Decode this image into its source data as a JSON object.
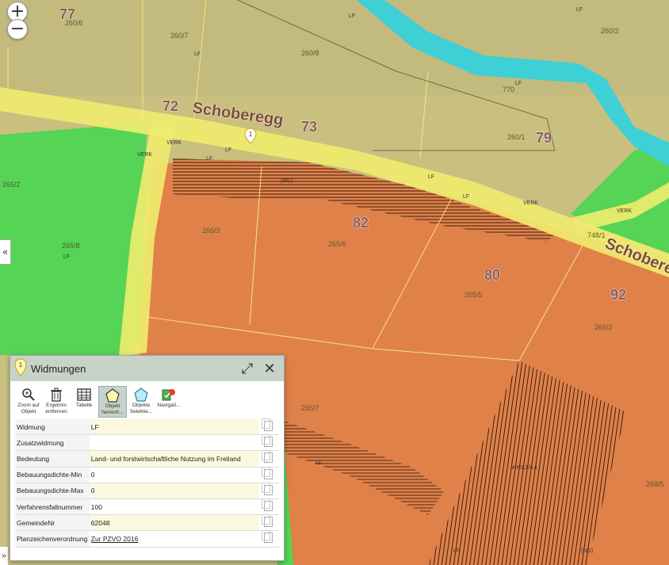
{
  "map": {
    "street_labels": [
      "Schoberegg",
      "Schobere"
    ],
    "house_numbers": [
      "77",
      "72",
      "73",
      "79",
      "82",
      "80",
      "92"
    ],
    "parcel_labels": [
      "260/6",
      "260/7",
      "260/8",
      "260/2",
      "770",
      "260/1",
      "265/2",
      "265/8",
      "265/3",
      "265/6",
      "265/5",
      "266/2",
      "748/1",
      "265/7",
      "268/5"
    ],
    "zone_labels": [
      "LF",
      "VERK",
      "(NG)",
      "WK0,2/0,4"
    ],
    "marker_number": "1",
    "colors": {
      "agricultural": "#c9c07f",
      "green": "#55d455",
      "building": "#e0814a",
      "road": "#f0ec6e",
      "water": "#3fd0d6"
    }
  },
  "controls": {
    "zoom_in": "+",
    "zoom_out": "−",
    "collapse": "«",
    "bottom_tab": "»"
  },
  "panel": {
    "title": "Widmungen",
    "marker": "1",
    "expand_icon": "expand-icon",
    "close_icon": "close-icon",
    "tools": [
      {
        "label": "Zoom auf Objekt",
        "icon": "zoom-icon"
      },
      {
        "label": "Ergebnis entfernen",
        "icon": "trash-icon"
      },
      {
        "label": "Tabelle",
        "icon": "table-icon"
      },
      {
        "label": "Objekt hervorh...",
        "icon": "pentagon-icon"
      },
      {
        "label": "Objekte Selektie...",
        "icon": "pentagon-select-icon"
      },
      {
        "label": "Navigati...",
        "icon": "navigation-icon"
      }
    ],
    "rows": [
      {
        "key": "Widmung",
        "value": "LF"
      },
      {
        "key": "Zusatzwidmung",
        "value": ""
      },
      {
        "key": "Bedeutung",
        "value": "Land- und forstwirtschaftliche Nutzung im Freiland"
      },
      {
        "key": "Bebauungsdichte-Min",
        "value": "0"
      },
      {
        "key": "Bebauungsdichte-Max",
        "value": "0"
      },
      {
        "key": "Verfahrensfallnummer",
        "value": "100"
      },
      {
        "key": "GemeindeNr",
        "value": "62048"
      },
      {
        "key": "Planzeichenverordnung",
        "value": "Zur PZVO 2016"
      }
    ]
  }
}
